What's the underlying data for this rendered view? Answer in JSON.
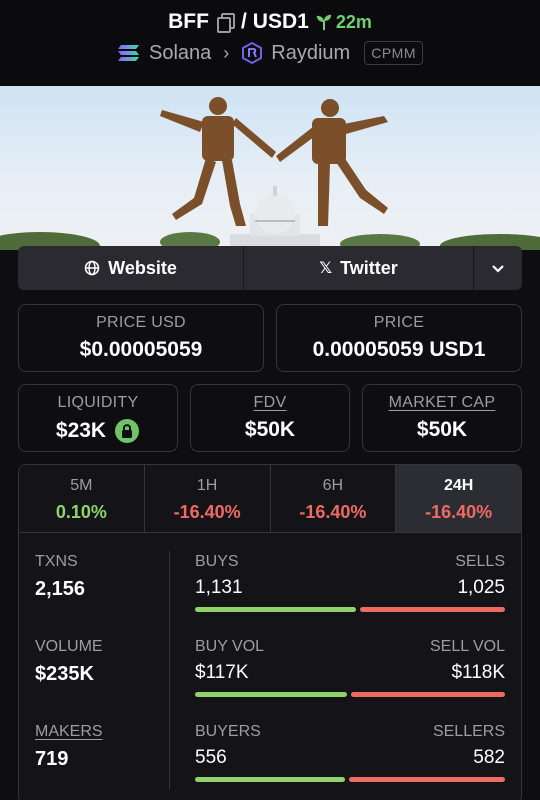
{
  "header": {
    "base_token": "BFF",
    "separator": "/",
    "quote_token": "USD1",
    "age": "22m",
    "chain": "Solana",
    "dex": "Raydium",
    "pool_type": "CPMM"
  },
  "links": {
    "website_label": "Website",
    "twitter_label": "Twitter"
  },
  "price": {
    "usd_label": "PRICE USD",
    "usd_value": "$0.00005059",
    "native_label": "PRICE",
    "native_value": "0.00005059 USD1"
  },
  "metrics": {
    "liquidity_label": "LIQUIDITY",
    "liquidity_value": "$23K",
    "fdv_label": "FDV",
    "fdv_value": "$50K",
    "mcap_label": "MARKET CAP",
    "mcap_value": "$50K"
  },
  "timeframes": [
    {
      "label": "5M",
      "change": "0.10%",
      "trend": "up",
      "active": false
    },
    {
      "label": "1H",
      "change": "-16.40%",
      "trend": "down",
      "active": false
    },
    {
      "label": "6H",
      "change": "-16.40%",
      "trend": "down",
      "active": false
    },
    {
      "label": "24H",
      "change": "-16.40%",
      "trend": "down",
      "active": true
    }
  ],
  "stats": {
    "txns_label": "TXNS",
    "txns_value": "2,156",
    "buys_label": "BUYS",
    "buys_value": "1,131",
    "sells_label": "SELLS",
    "sells_value": "1,025",
    "buys_ratio": 0.5246,
    "volume_label": "VOLUME",
    "volume_value": "$235K",
    "buy_vol_label": "BUY VOL",
    "buy_vol_value": "$117K",
    "sell_vol_label": "SELL VOL",
    "sell_vol_value": "$118K",
    "buy_vol_ratio": 0.4979,
    "makers_label": "MAKERS",
    "makers_value": "719",
    "buyers_label": "BUYERS",
    "buyers_value": "556",
    "sellers_label": "SELLERS",
    "sellers_value": "582",
    "buyers_ratio": 0.4886
  },
  "colors": {
    "positive": "#8fd36a",
    "negative": "#ef6a63",
    "accent_age": "#6fcf6f"
  }
}
